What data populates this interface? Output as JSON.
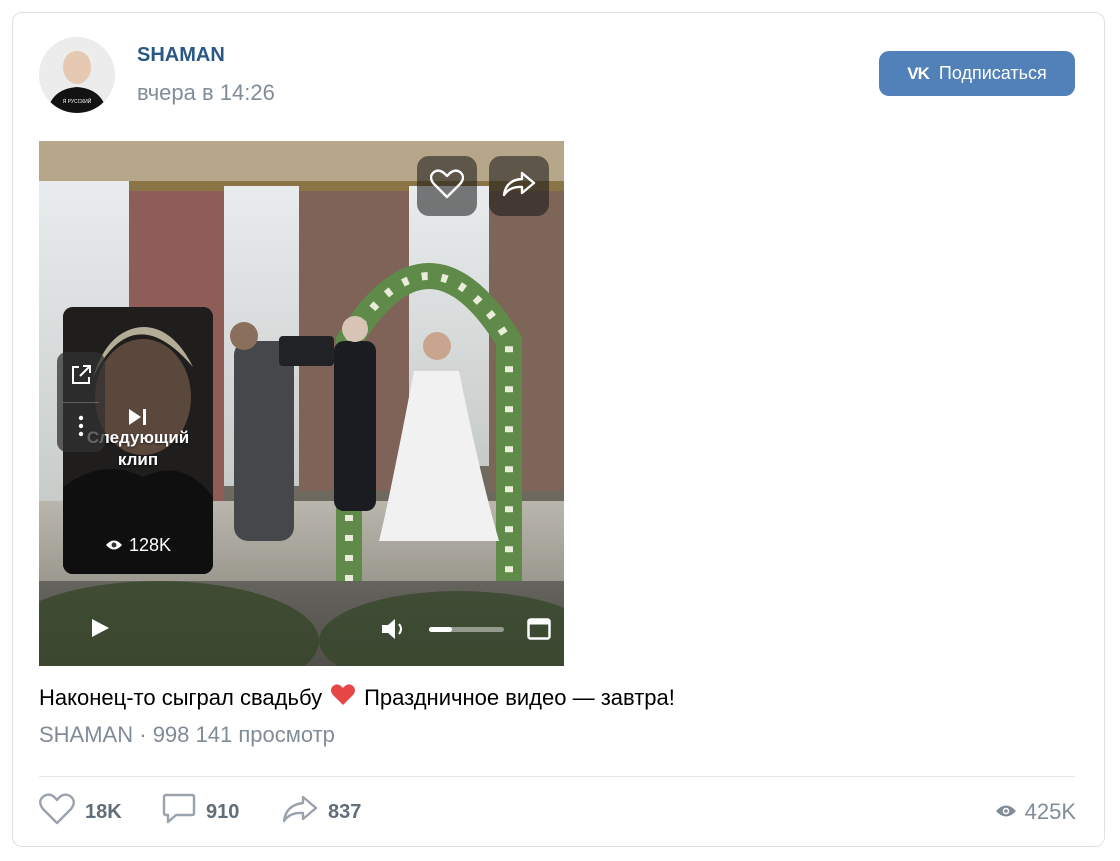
{
  "post": {
    "author": "SHAMAN",
    "time": "вчера в 14:26",
    "subscribe_label": "Подписаться",
    "subscribe_logo": "VK"
  },
  "video": {
    "next_clip_label_line1": "Следующий",
    "next_clip_label_line2": "клип",
    "next_clip_views": "128K",
    "volume_level": 0.3
  },
  "caption": {
    "text_before": "Наконец-то сыграл свадьбу",
    "emoji": "heart-emoji",
    "text_after": "Праздничное видео — завтра!"
  },
  "meta": {
    "source": "SHAMAN",
    "separator": " · ",
    "views": "998 141 просмотр"
  },
  "actions": {
    "likes": "18K",
    "comments": "910",
    "shares": "837",
    "views": "425K"
  },
  "colors": {
    "accent": "#5181b8",
    "link": "#2a5885",
    "muted": "#818c99",
    "heart": "#e64646"
  }
}
